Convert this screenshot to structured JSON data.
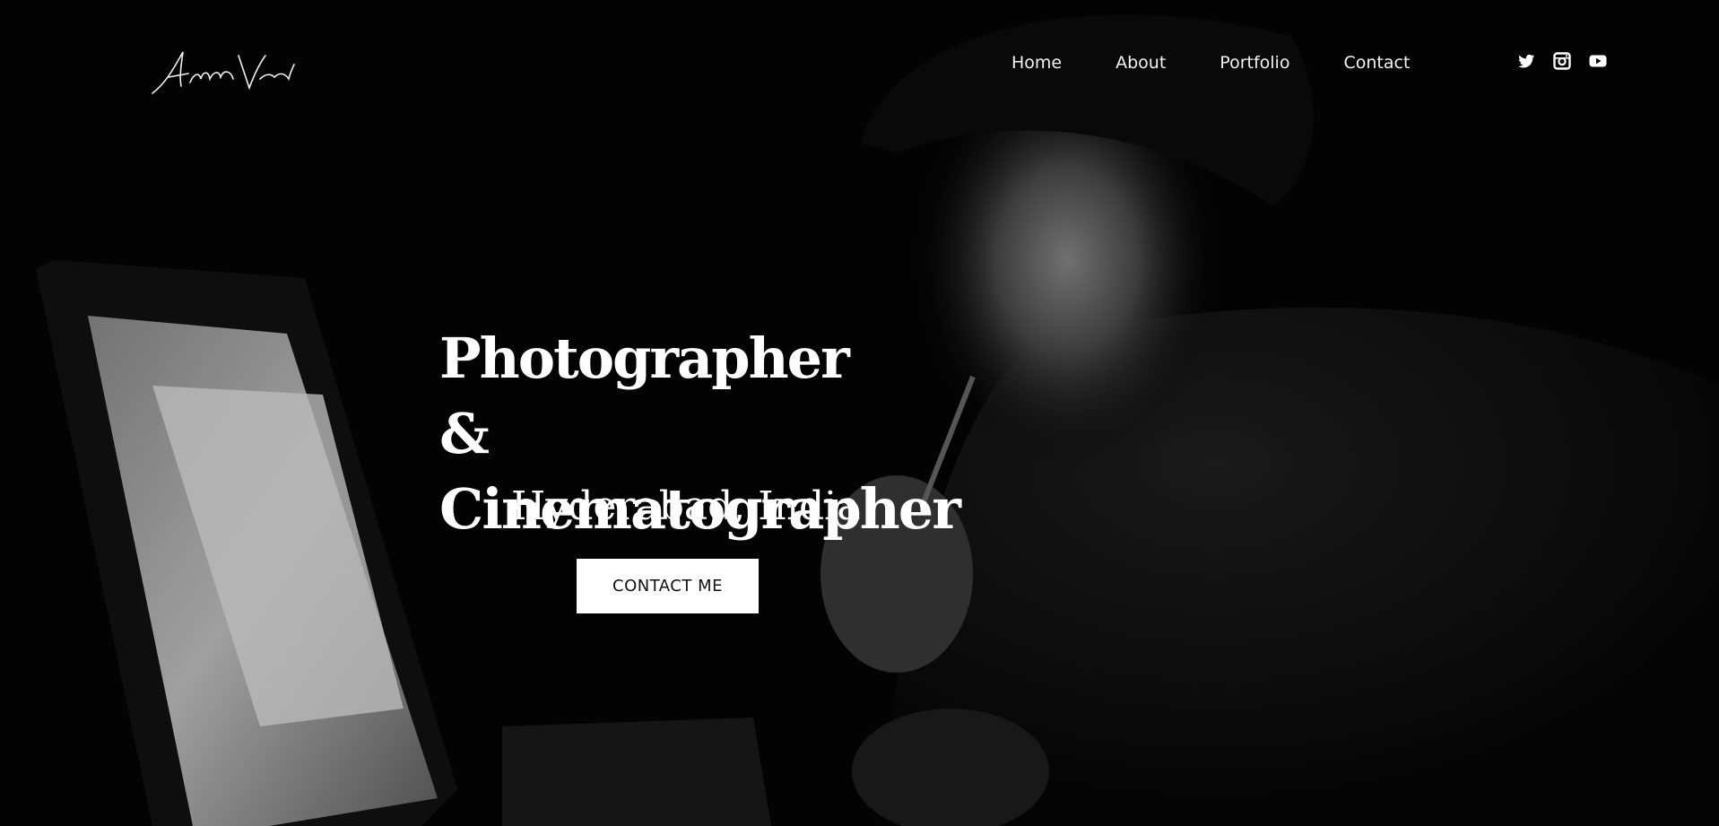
{
  "header": {
    "logo_text": "Adithya Vanasiddi"
  },
  "nav": {
    "items": [
      {
        "label": "Home"
      },
      {
        "label": "About"
      },
      {
        "label": "Portfolio"
      },
      {
        "label": "Contact"
      }
    ]
  },
  "social": {
    "icons": [
      "twitter-icon",
      "instagram-icon",
      "youtube-icon"
    ]
  },
  "hero": {
    "headline_line1": "Photographer &",
    "headline_line2": "Cinematographer",
    "location": "Hyderabad, India",
    "cta_label": "CONTACT ME"
  },
  "colors": {
    "background": "#000000",
    "text": "#ffffff",
    "button_bg": "#ffffff",
    "button_text": "#111111"
  }
}
